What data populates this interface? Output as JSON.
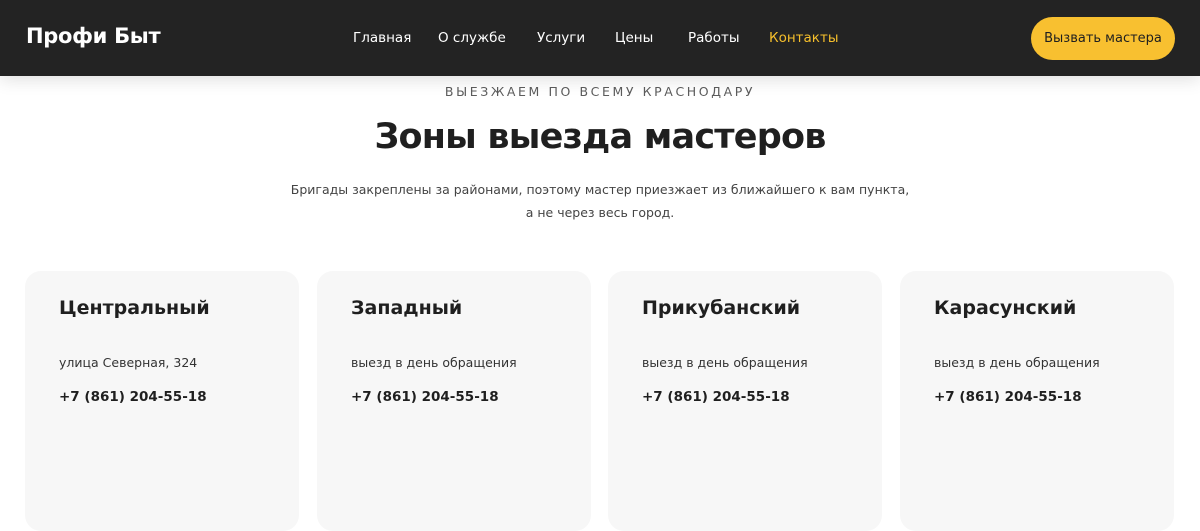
{
  "header": {
    "logo": "Профи Быт",
    "nav": [
      {
        "label": "Главная",
        "active": false
      },
      {
        "label": "О службе",
        "active": false
      },
      {
        "label": "Услуги",
        "active": false
      },
      {
        "label": "Цены",
        "active": false
      },
      {
        "label": "Работы",
        "active": false
      },
      {
        "label": "Контакты",
        "active": true
      }
    ],
    "cta_label": "Вызвать мастера"
  },
  "section": {
    "kicker": "ВЫЕЗЖАЕМ ПО ВСЕМУ КРАСНОДАРУ",
    "title": "Зоны выезда мастеров",
    "subtitle_line1": "Бригады закреплены за районами, поэтому мастер приезжает из ближайшего к вам пункта,",
    "subtitle_line2": "а не через весь город."
  },
  "zones": [
    {
      "name": "Центральный",
      "note": "улица Северная, 324",
      "phone": "+7 (861) 204-55-18"
    },
    {
      "name": "Западный",
      "note": "выезд в день обращения",
      "phone": "+7 (861) 204-55-18"
    },
    {
      "name": "Прикубанский",
      "note": "выезд в день обращения",
      "phone": "+7 (861) 204-55-18"
    },
    {
      "name": "Карасунский",
      "note": "выезд в день обращения",
      "phone": "+7 (861) 204-55-18"
    }
  ],
  "colors": {
    "header_bg": "#232323",
    "accent": "#f8c030",
    "active_nav": "#f6bf2b",
    "card_bg": "#f7f7f7"
  }
}
